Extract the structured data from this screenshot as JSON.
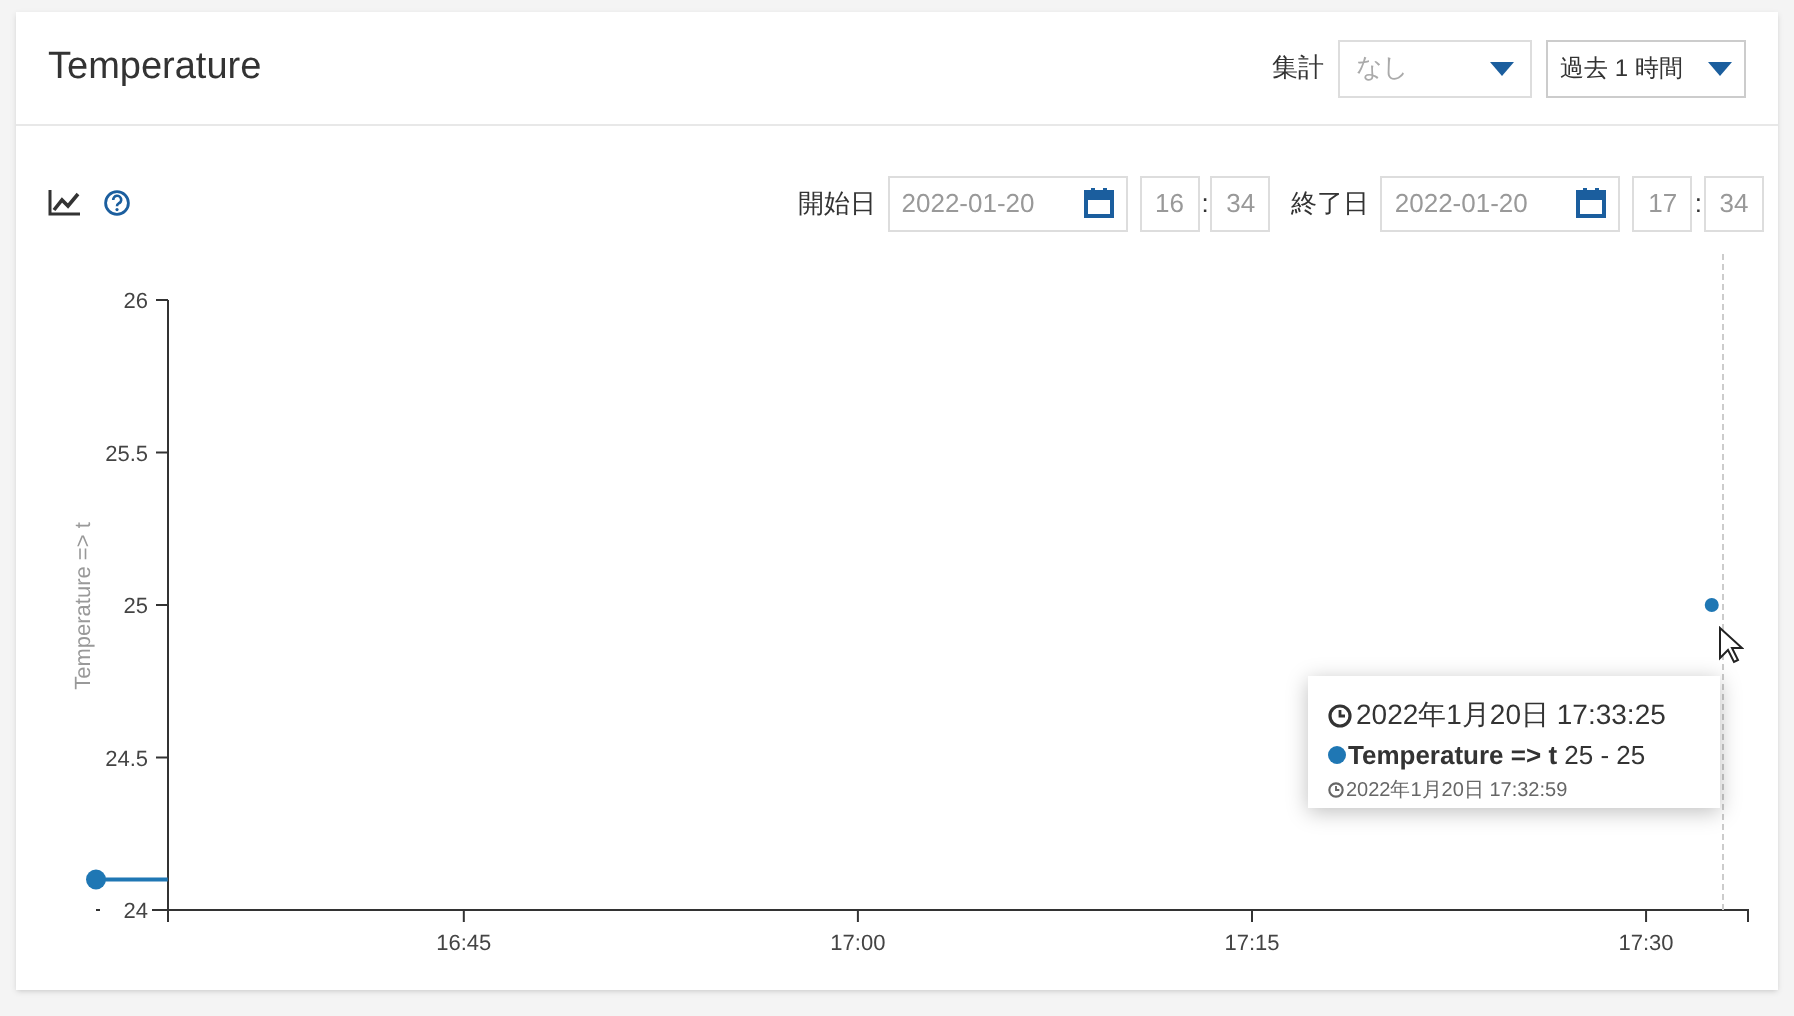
{
  "panel": {
    "title": "Temperature"
  },
  "aggregate": {
    "label": "集計",
    "placeholder": "なし"
  },
  "range_select": {
    "value": "過去 1 時間"
  },
  "start": {
    "label": "開始日",
    "date": "2022-01-20",
    "hour": "16",
    "separator": ":",
    "minute": "34"
  },
  "end": {
    "label": "終了日",
    "date": "2022-01-20",
    "hour": "17",
    "separator": ":",
    "minute": "34"
  },
  "chart": {
    "chart_data": {
      "type": "line",
      "ylabel": "Temperature => t",
      "x": [
        991,
        993.73,
        1052.5
      ],
      "series": [
        {
          "color": "#1f77b4",
          "marker": "circle",
          "values": [
            24.1,
            24.1,
            null
          ]
        },
        {
          "color": "#1f77b4",
          "marker": "circle",
          "values": [
            null,
            null,
            25
          ]
        }
      ],
      "xlim": [
        991,
        1053.88
      ],
      "ylim": [
        24,
        26
      ],
      "xticks": [
        {
          "value": 1005,
          "label": "16:45"
        },
        {
          "value": 1020,
          "label": "17:00"
        },
        {
          "value": 1035,
          "label": "17:15"
        },
        {
          "value": 1050,
          "label": "17:30"
        }
      ],
      "yticks": [
        24,
        24.5,
        25,
        25.5,
        26
      ]
    }
  },
  "tooltip": {
    "time": "2022年1月20日 17:33:25",
    "entry": "**Temperature => t** 25 - 25",
    "color": "#1f77b4",
    "sample_time": "2022年1月20日 17:32:59"
  }
}
